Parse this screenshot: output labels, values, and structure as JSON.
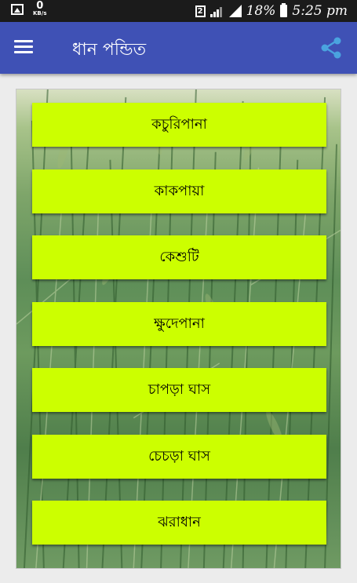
{
  "status_bar": {
    "data_speed": "0",
    "data_speed_unit": "KB/s",
    "sim": "2",
    "battery": "18%",
    "time": "5:25 pm"
  },
  "app_bar": {
    "title": "ধান পন্ডিত"
  },
  "buttons": [
    "কচুরিপানা",
    "কাকপায়া",
    "কেশুটি",
    "ক্ষুদেপানা",
    "চাপড়া ঘাস",
    "চেচড়া  ঘাস",
    "ঝরাধান"
  ],
  "icons": {
    "menu": "hamburger-menu-icon",
    "share": "share-icon"
  },
  "colors": {
    "app_bar": "#3f51b5",
    "button": "#ccff00",
    "share_icon": "#4aa3df"
  }
}
